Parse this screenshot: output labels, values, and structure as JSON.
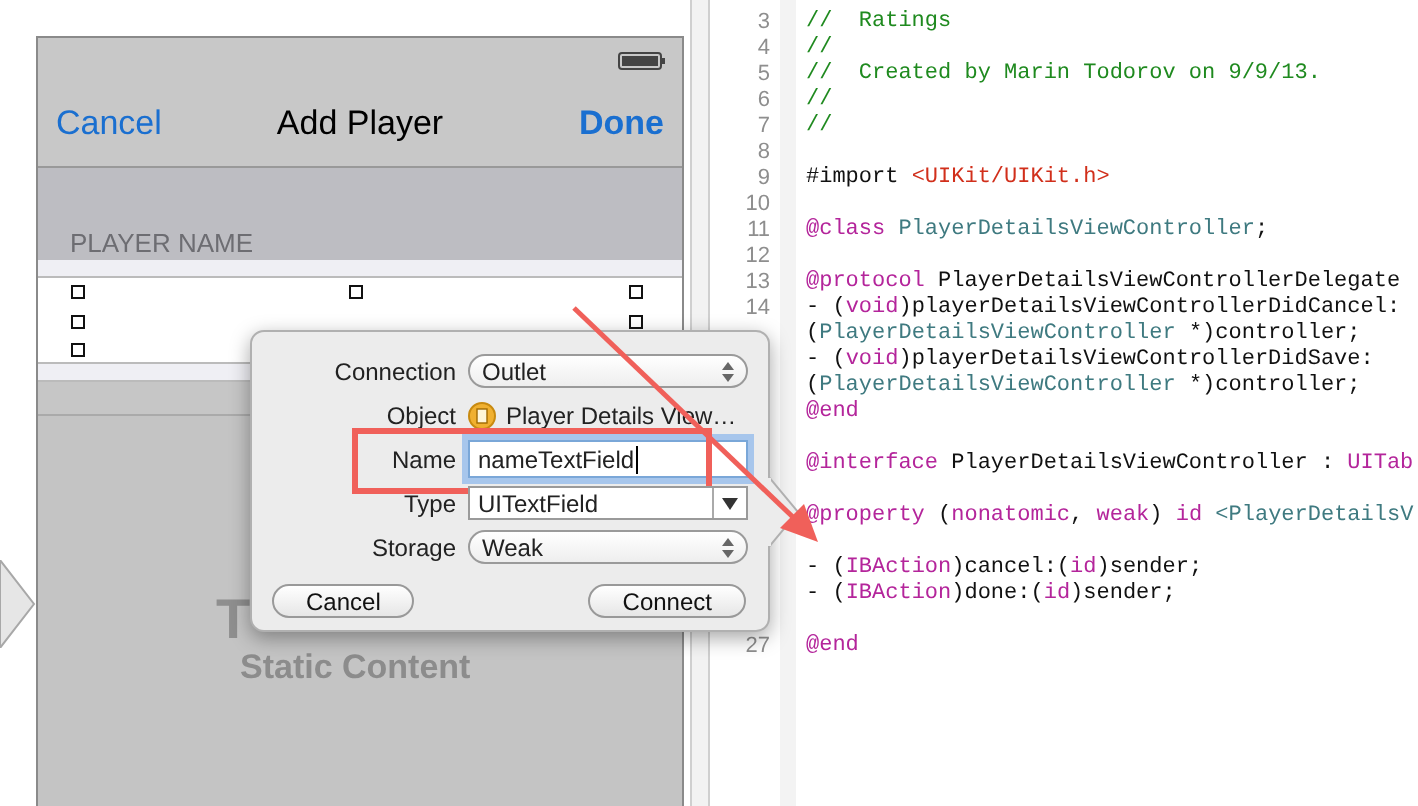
{
  "storyboard": {
    "nav_bar": {
      "left_button": "Cancel",
      "title": "Add Player",
      "right_button": "Done"
    },
    "section_header": "PLAYER NAME",
    "table_label": "T",
    "table_caption": "Static Content"
  },
  "connection_popover": {
    "rows": [
      {
        "label": "Connection",
        "kind": "popup",
        "value": "Outlet",
        "highlighted": false
      },
      {
        "label": "Object",
        "kind": "object",
        "value": "Player Details View…",
        "highlighted": false
      },
      {
        "label": "Name",
        "kind": "field",
        "value": "nameTextField",
        "highlighted": true
      },
      {
        "label": "Type",
        "kind": "combo",
        "value": "UITextField",
        "highlighted": false
      },
      {
        "label": "Storage",
        "kind": "popup",
        "value": "Weak",
        "highlighted": false
      }
    ],
    "buttons": [
      "Cancel",
      "Connect"
    ]
  },
  "editor": {
    "lines": [
      {
        "kind": "code",
        "number": "3",
        "tokens": [
          {
            "text": "//  Ratings",
            "kind": "comment"
          }
        ]
      },
      {
        "kind": "code",
        "number": "4",
        "tokens": [
          {
            "text": "//",
            "kind": "comment"
          }
        ]
      },
      {
        "kind": "code",
        "number": "5",
        "tokens": [
          {
            "text": "//  Created by Marin Todorov on 9/9/13.",
            "kind": "comment"
          }
        ]
      },
      {
        "kind": "code",
        "number": "6",
        "tokens": [
          {
            "text": "//",
            "kind": "comment"
          }
        ]
      },
      {
        "kind": "code",
        "number": "7",
        "tokens": [
          {
            "text": "//",
            "kind": "comment"
          }
        ]
      },
      {
        "kind": "blank",
        "number": "8"
      },
      {
        "kind": "code",
        "number": "9",
        "tokens": [
          {
            "text": "#import ",
            "kind": "plain"
          },
          {
            "text": "<UIKit/UIKit.h>",
            "kind": "string"
          }
        ]
      },
      {
        "kind": "blank",
        "number": "10"
      },
      {
        "kind": "code",
        "number": "11",
        "tokens": [
          {
            "text": "@class",
            "kind": "keyword"
          },
          {
            "text": " PlayerDetailsViewController",
            "kind": "class"
          },
          {
            "text": ";",
            "kind": "plain"
          }
        ]
      },
      {
        "kind": "blank",
        "number": "12"
      },
      {
        "kind": "code",
        "number": "13",
        "tokens": [
          {
            "text": "@protocol",
            "kind": "keyword"
          },
          {
            "text": " PlayerDetailsViewControllerDelegate",
            "kind": "plain"
          }
        ]
      },
      {
        "kind": "code",
        "number": "14",
        "tokens": [
          {
            "text": "- (",
            "kind": "plain"
          },
          {
            "text": "void",
            "kind": "keyword"
          },
          {
            "text": ")playerDetailsViewControllerDidCancel:",
            "kind": "plain"
          }
        ]
      },
      {
        "kind": "code",
        "tokens": [
          {
            "text": "(",
            "kind": "plain"
          },
          {
            "text": "PlayerDetailsViewController",
            "kind": "class"
          },
          {
            "text": " *)controller;",
            "kind": "plain"
          }
        ]
      },
      {
        "kind": "code",
        "tokens": [
          {
            "text": "- (",
            "kind": "plain"
          },
          {
            "text": "void",
            "kind": "keyword"
          },
          {
            "text": ")playerDetailsViewControllerDidSave:",
            "kind": "plain"
          }
        ]
      },
      {
        "kind": "code",
        "tokens": [
          {
            "text": "(",
            "kind": "plain"
          },
          {
            "text": "PlayerDetailsViewController",
            "kind": "class"
          },
          {
            "text": " *)controller;",
            "kind": "plain"
          }
        ]
      },
      {
        "kind": "code",
        "tokens": [
          {
            "text": "@end",
            "kind": "keyword"
          }
        ]
      },
      {
        "kind": "blank"
      },
      {
        "kind": "code",
        "tokens": [
          {
            "text": "@interface",
            "kind": "keyword"
          },
          {
            "text": " PlayerDetailsViewController : ",
            "kind": "plain"
          },
          {
            "text": "UITab",
            "kind": "keyword"
          }
        ]
      },
      {
        "kind": "blank"
      },
      {
        "kind": "code",
        "tokens": [
          {
            "text": "@property",
            "kind": "keyword"
          },
          {
            "text": " (",
            "kind": "plain"
          },
          {
            "text": "nonatomic",
            "kind": "keyword"
          },
          {
            "text": ", ",
            "kind": "plain"
          },
          {
            "text": "weak",
            "kind": "keyword"
          },
          {
            "text": ") ",
            "kind": "plain"
          },
          {
            "text": "id",
            "kind": "keyword"
          },
          {
            "text": " <PlayerDetailsV",
            "kind": "class"
          }
        ]
      },
      {
        "kind": "blank"
      },
      {
        "kind": "code",
        "tokens": [
          {
            "text": "- (",
            "kind": "plain"
          },
          {
            "text": "IBAction",
            "kind": "keyword"
          },
          {
            "text": ")cancel:(",
            "kind": "plain"
          },
          {
            "text": "id",
            "kind": "keyword"
          },
          {
            "text": ")sender;",
            "kind": "plain"
          }
        ]
      },
      {
        "kind": "code",
        "tokens": [
          {
            "text": "- (",
            "kind": "plain"
          },
          {
            "text": "IBAction",
            "kind": "keyword"
          },
          {
            "text": ")done:(",
            "kind": "plain"
          },
          {
            "text": "id",
            "kind": "keyword"
          },
          {
            "text": ")sender;",
            "kind": "plain"
          }
        ]
      },
      {
        "kind": "blank"
      },
      {
        "kind": "code",
        "number": "27",
        "tokens": [
          {
            "text": "@end",
            "kind": "keyword"
          }
        ]
      }
    ]
  }
}
